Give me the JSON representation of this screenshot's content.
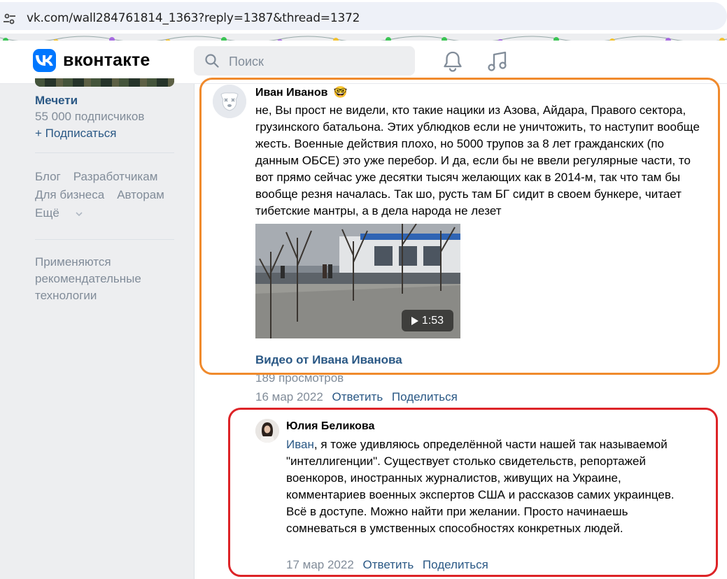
{
  "browser": {
    "url": "vk.com/wall284761814_1363?reply=1387&thread=1372"
  },
  "header": {
    "brand": "вконтакте",
    "search_placeholder": "Поиск",
    "brand_color": "#0077ff"
  },
  "sidebar": {
    "group_name": "Мечети",
    "group_subscribers": "55 000 подписчиков",
    "subscribe_label": "+ Подписаться",
    "links": [
      "Блог",
      "Разработчикам",
      "Для бизнеса",
      "Авторам",
      "Ещё"
    ],
    "note": "Применяются рекомендательные технологии"
  },
  "comment1": {
    "author": "Иван Иванов",
    "author_emoji": "🤓",
    "text": "не, Вы прост не видели, кто такие нацики из Азова, Айдара, Правого сектора, грузинского батальона. Этих ублюдков если не уничтожить, то наступит вообще жесть. Военные действия плохо, но 5000 трупов за 8 лет гражданских (по данным ОБСЕ) это уже перебор. И да, если бы не ввели регулярные части, то вот прямо сейчас уже десятки тысяч желающих как в 2014-м, так что там бы вообще резня началась. Так шо, русть там БГ сидит в своем бункере, читает тибетские мантры, а в дела народа не лезет",
    "video": {
      "duration": "1:53",
      "title": "Видео от Ивана Иванова",
      "views": "189 просмотров"
    },
    "date": "16 мар 2022",
    "reply_label": "Ответить",
    "share_label": "Поделиться"
  },
  "comment2": {
    "author": "Юлия Беликова",
    "mention": "Иван",
    "text": ", я тоже удивляюсь определённой части нашей так называемой \"интеллигенции\". Существует столько свидетельств, репортажей военкоров, иностранных журналистов, живущих на Украине, комментариев военных экспертов США и рассказов самих украинцев. Всё в доступе. Можно найти при желании. Просто начинаешь сомневаться в умственных способностях конкретных людей.",
    "date": "17 мар 2022",
    "reply_label": "Ответить",
    "share_label": "Поделиться"
  },
  "highlights": {
    "first_color": "#f08a2c",
    "second_color": "#dd2327"
  }
}
